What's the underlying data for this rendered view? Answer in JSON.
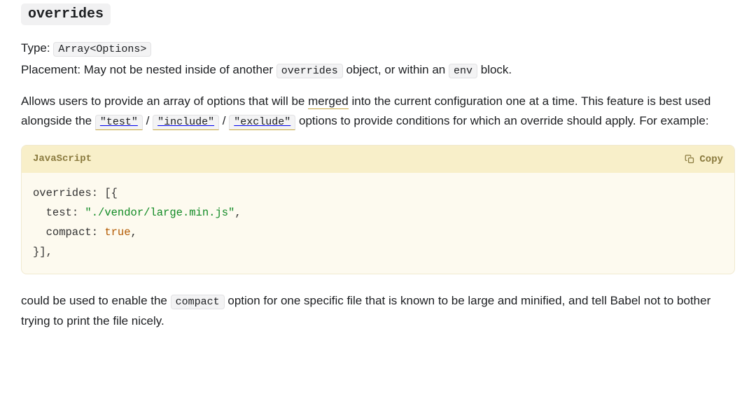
{
  "heading": "overrides",
  "type_label": "Type:",
  "type_value": "Array<Options>",
  "placement_prefix": "Placement: May not be nested inside of another ",
  "placement_code1": "overrides",
  "placement_mid": " object, or within an ",
  "placement_code2": "env",
  "placement_suffix": " block.",
  "desc_p1_a": "Allows users to provide an array of options that will be ",
  "desc_p1_link": "merged",
  "desc_p1_b": " into the current configuration one at a time. This feature is best used alongside the ",
  "desc_code_test": "\"test\"",
  "desc_sep": " / ",
  "desc_code_include": "\"include\"",
  "desc_code_exclude": "\"exclude\"",
  "desc_p1_c": " options to provide conditions for which an override should apply. For example:",
  "codeblock": {
    "lang": "JavaScript",
    "copy": "Copy",
    "line1_a": "overrides",
    "line1_b": ": [{",
    "line2_a": "  test",
    "line2_b": ": ",
    "line2_str": "\"./vendor/large.min.js\"",
    "line2_c": ",",
    "line3_a": "  compact",
    "line3_b": ": ",
    "line3_bool": "true",
    "line3_c": ",",
    "line4": "}],"
  },
  "desc_p2_a": "could be used to enable the ",
  "desc_p2_code": "compact",
  "desc_p2_b": " option for one specific file that is known to be large and minified, and tell Babel not to bother trying to print the file nicely."
}
